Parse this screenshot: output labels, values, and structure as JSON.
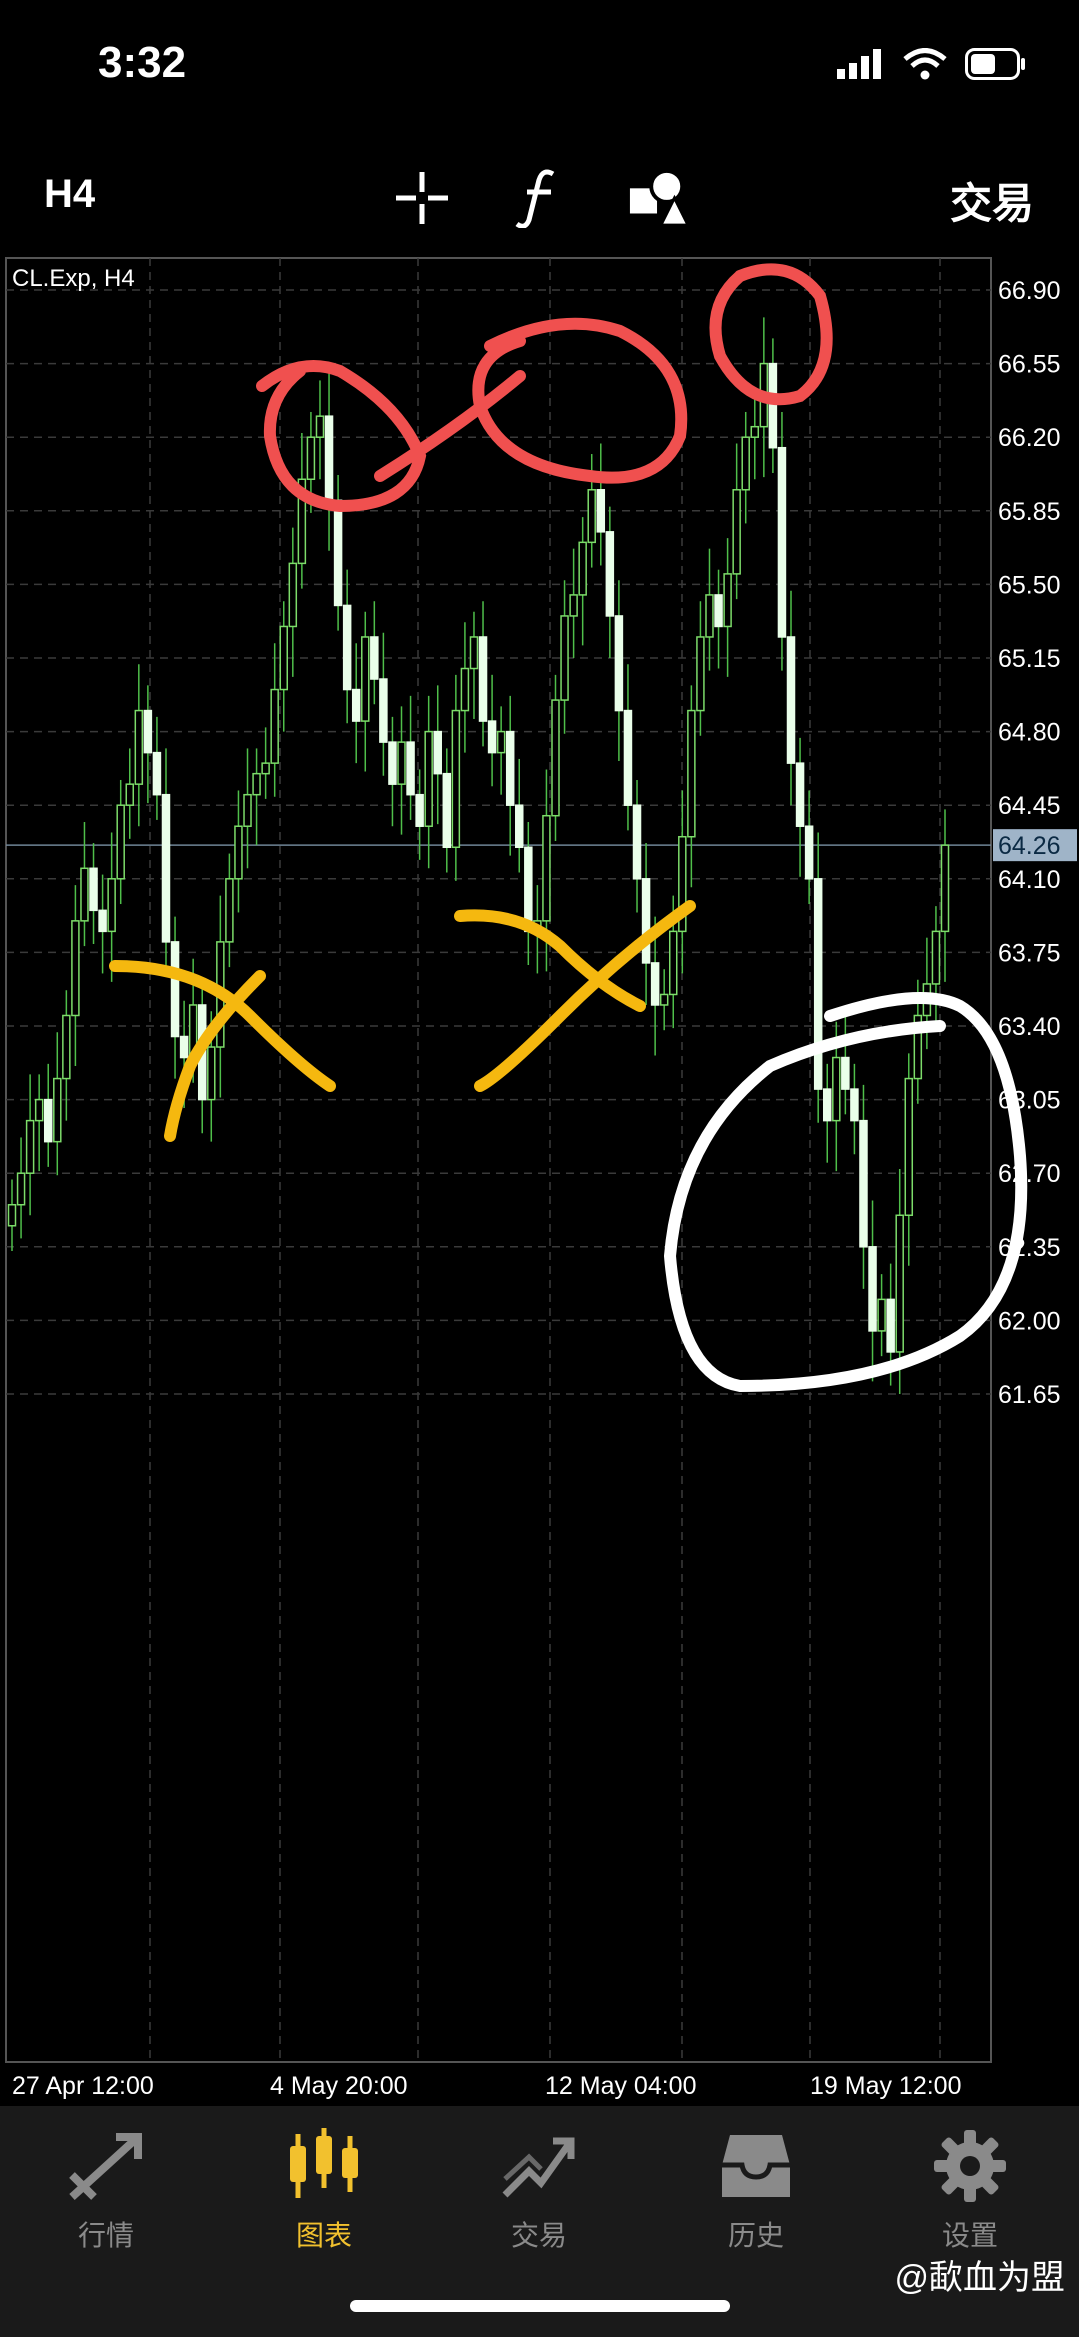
{
  "status_bar": {
    "time": "3:32"
  },
  "toolbar": {
    "timeframe": "H4",
    "trade_label": "交易",
    "tools": [
      "crosshair-icon",
      "indicator-f-icon",
      "objects-icon"
    ]
  },
  "chart": {
    "symbol_label": "CL.Exp, H4",
    "price_labels": [
      "66.90",
      "66.55",
      "66.20",
      "65.85",
      "65.50",
      "65.15",
      "64.80",
      "64.45",
      "64.10",
      "63.75",
      "63.40",
      "63.05",
      "62.70",
      "62.35",
      "62.00",
      "61.65"
    ],
    "current_price": "64.26",
    "time_labels": [
      "27 Apr 12:00",
      "4 May 20:00",
      "12 May 04:00",
      "19 May 12:00"
    ],
    "colors": {
      "bull": "#7ddc6a",
      "bear": "#eaffea",
      "wick": "#4fbf4a",
      "grid": "#3a3a3a",
      "price_tag": "#9fb4c8"
    }
  },
  "chart_data": {
    "type": "candlestick",
    "symbol": "CL.Exp",
    "timeframe": "H4",
    "ylim": [
      61.5,
      67.05
    ],
    "x_ticks": [
      "27 Apr 12:00",
      "4 May 20:00",
      "12 May 04:00",
      "19 May 12:00"
    ],
    "y_ticks": [
      66.9,
      66.55,
      66.2,
      65.85,
      65.5,
      65.15,
      64.8,
      64.45,
      64.1,
      63.75,
      63.4,
      63.05,
      62.7,
      62.35,
      62.0,
      61.65
    ],
    "last_price": 64.26,
    "closes": [
      62.55,
      62.7,
      62.95,
      63.05,
      62.85,
      63.15,
      63.45,
      63.9,
      64.15,
      63.95,
      63.85,
      64.1,
      64.45,
      64.55,
      64.9,
      64.7,
      64.5,
      63.8,
      63.35,
      63.25,
      63.5,
      63.05,
      63.3,
      63.8,
      64.1,
      64.35,
      64.5,
      64.6,
      64.65,
      65.0,
      65.3,
      65.6,
      66.0,
      66.2,
      66.3,
      65.9,
      65.4,
      65.0,
      64.85,
      65.25,
      65.05,
      64.75,
      64.55,
      64.75,
      64.5,
      64.35,
      64.8,
      64.6,
      64.25,
      64.9,
      65.1,
      65.25,
      64.85,
      64.7,
      64.8,
      64.45,
      64.25,
      63.85,
      63.9,
      64.4,
      64.95,
      65.35,
      65.45,
      65.7,
      65.95,
      65.75,
      65.35,
      64.9,
      64.45,
      64.1,
      63.7,
      63.5,
      63.55,
      63.85,
      64.3,
      64.9,
      65.25,
      65.45,
      65.3,
      65.55,
      65.95,
      66.2,
      66.25,
      66.55,
      66.15,
      65.25,
      64.65,
      64.35,
      64.1,
      63.1,
      62.95,
      63.25,
      63.1,
      62.95,
      62.35,
      61.95,
      62.1,
      61.85,
      62.5,
      63.15,
      63.45,
      63.6,
      63.85,
      64.26
    ],
    "annotations": [
      "red circles at the three tops",
      "yellow X marks at the two bottoms",
      "white circle around the latest decline"
    ]
  },
  "tabs": [
    {
      "label": "行情",
      "icon": "quotes-icon",
      "active": false
    },
    {
      "label": "图表",
      "icon": "chart-icon",
      "active": true
    },
    {
      "label": "交易",
      "icon": "trade-icon",
      "active": false
    },
    {
      "label": "历史",
      "icon": "history-icon",
      "active": false
    },
    {
      "label": "设置",
      "icon": "gear-icon",
      "active": false
    }
  ],
  "watermark": "@歃血为盟"
}
